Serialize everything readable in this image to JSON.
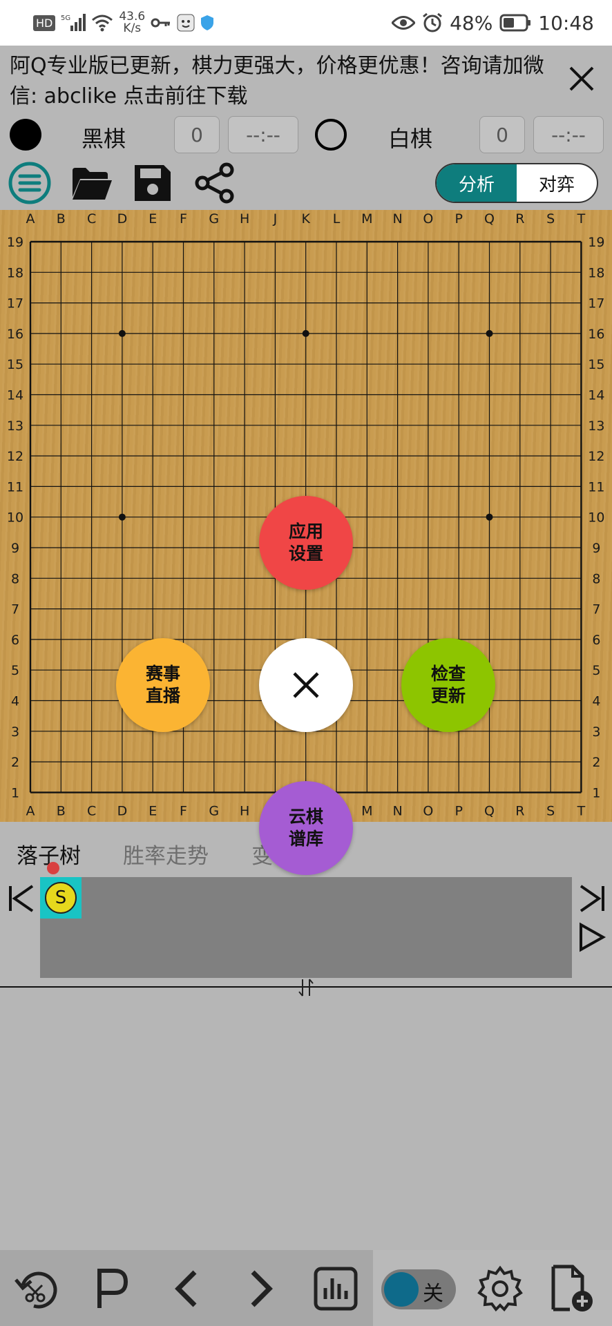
{
  "status_bar": {
    "network_badge": "HD",
    "signal": "5G",
    "speed_value": "43.6",
    "speed_unit": "K/s",
    "battery": "48%",
    "time": "10:48"
  },
  "banner": {
    "text": "阿Q专业版已更新，棋力更强大，价格更优惠！咨询请加微信: abclike 点击前往下载"
  },
  "players": {
    "black": {
      "name": "黑棋",
      "captures": "0",
      "time": "--:--"
    },
    "white": {
      "name": "白棋",
      "captures": "0",
      "time": "--:--"
    }
  },
  "mode_toggle": {
    "analysis": "分析",
    "play": "对弈",
    "selected": "analysis"
  },
  "board": {
    "size": 19,
    "columns": [
      "A",
      "B",
      "C",
      "D",
      "E",
      "F",
      "G",
      "H",
      "J",
      "K",
      "L",
      "M",
      "N",
      "O",
      "P",
      "Q",
      "R",
      "S",
      "T"
    ],
    "rows": [
      "19",
      "18",
      "17",
      "16",
      "15",
      "14",
      "13",
      "12",
      "11",
      "10",
      "9",
      "8",
      "7",
      "6",
      "5",
      "4",
      "3",
      "2",
      "1"
    ],
    "star_points": [
      "D16",
      "K16",
      "Q16",
      "D10",
      "Q10"
    ]
  },
  "fab_menu": {
    "settings": "应用\n设置",
    "live": "赛事\n直播",
    "update": "检查\n更新",
    "cloud": "云棋\n谱库",
    "colors": {
      "settings": "#f04646",
      "live": "#fbb433",
      "update": "#8dc500",
      "cloud": "#a55cd3",
      "close": "#ffffff"
    }
  },
  "tabs": {
    "tree": "落子树",
    "trend": "胜率走势",
    "partial": "变"
  },
  "tree": {
    "root_label": "S"
  },
  "bottom": {
    "toggle_label": "关"
  }
}
